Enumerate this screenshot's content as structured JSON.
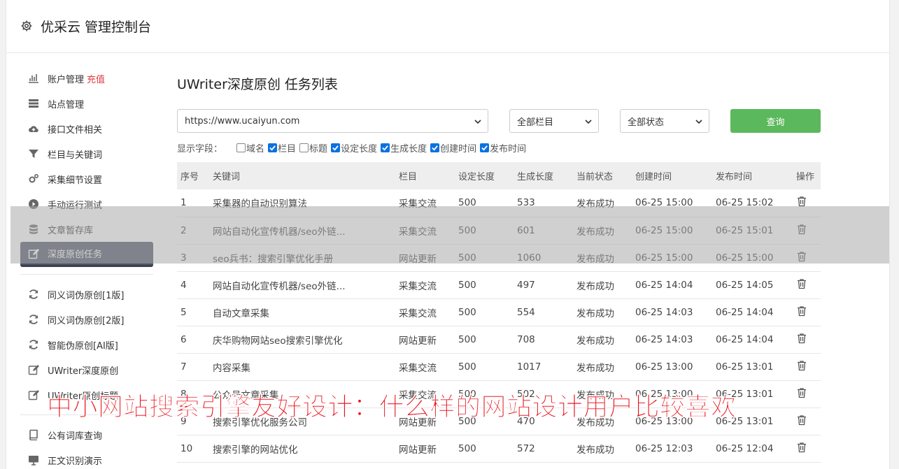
{
  "header": {
    "title": "优采云 管理控制台"
  },
  "sidebar": {
    "group1": [
      {
        "label": "账户管理",
        "accent": "充值",
        "icon": "bar-chart-icon"
      },
      {
        "label": "站点管理",
        "icon": "server-icon"
      },
      {
        "label": "接口文件相关",
        "icon": "cloud-upload-icon"
      },
      {
        "label": "栏目与关键词",
        "icon": "filter-icon"
      },
      {
        "label": "采集细节设置",
        "icon": "cogs-icon"
      },
      {
        "label": "手动运行测试",
        "icon": "play-icon"
      },
      {
        "label": "文章暂存库",
        "icon": "database-icon"
      },
      {
        "label": "深度原创任务",
        "icon": "edit-icon"
      }
    ],
    "group2": [
      {
        "label": "同义词伪原创[1版]",
        "icon": "refresh-icon"
      },
      {
        "label": "同义词伪原创[2版]",
        "icon": "refresh-icon"
      },
      {
        "label": "智能伪原创[AI版]",
        "icon": "refresh-icon"
      },
      {
        "label": "UWriter深度原创",
        "icon": "edit-icon"
      },
      {
        "label": "UWriter原创标题",
        "icon": "edit-icon"
      }
    ],
    "group3": [
      {
        "label": "公有词库查询",
        "icon": "book-icon"
      },
      {
        "label": "正文识别演示",
        "icon": "monitor-icon"
      }
    ]
  },
  "main": {
    "title": "UWriter深度原创 任务列表",
    "site_select": "https://www.ucaiyun.com",
    "column_select": "全部栏目",
    "status_select": "全部状态",
    "query_label": "查询",
    "fields_label": "显示字段：",
    "fields": [
      {
        "label": "域名",
        "checked": false
      },
      {
        "label": "栏目",
        "checked": true
      },
      {
        "label": "标题",
        "checked": false
      },
      {
        "label": "设定长度",
        "checked": true
      },
      {
        "label": "生成长度",
        "checked": true
      },
      {
        "label": "创建时间",
        "checked": true
      },
      {
        "label": "发布时间",
        "checked": true
      }
    ],
    "columns": [
      "序号",
      "关键词",
      "栏目",
      "设定长度",
      "生成长度",
      "当前状态",
      "创建时间",
      "发布时间",
      "操作"
    ],
    "rows": [
      [
        "1",
        "采集器的自动识别算法",
        "采集交流",
        "500",
        "533",
        "发布成功",
        "06-25 15:00",
        "06-25 15:02"
      ],
      [
        "2",
        "网站自动化宣传机器/seo外链...",
        "采集交流",
        "500",
        "601",
        "发布成功",
        "06-25 15:00",
        "06-25 15:01"
      ],
      [
        "3",
        "seo兵书：搜索引擎优化手册",
        "网站更新",
        "500",
        "1060",
        "发布成功",
        "06-25 15:00",
        "06-25 15:00"
      ],
      [
        "4",
        "网站自动化宣传机器/seo外链...",
        "采集交流",
        "500",
        "497",
        "发布成功",
        "06-25 14:04",
        "06-25 14:05"
      ],
      [
        "5",
        "自动文章采集",
        "采集交流",
        "500",
        "554",
        "发布成功",
        "06-25 14:03",
        "06-25 14:04"
      ],
      [
        "6",
        "庆华购物网站seo搜索引擎优化",
        "网站更新",
        "500",
        "708",
        "发布成功",
        "06-25 14:03",
        "06-25 14:04"
      ],
      [
        "7",
        "内容采集",
        "采集交流",
        "500",
        "1017",
        "发布成功",
        "06-25 13:00",
        "06-25 13:01"
      ],
      [
        "8",
        "公众号文章采集",
        "采集交流",
        "500",
        "502",
        "发布成功",
        "06-25 13:00",
        "06-25 13:01"
      ],
      [
        "9",
        "搜索引擎优化服务公司",
        "网站更新",
        "500",
        "470",
        "发布成功",
        "06-25 13:00",
        "06-25 13:01"
      ],
      [
        "10",
        "搜索引擎的网站优化",
        "网站更新",
        "500",
        "572",
        "发布成功",
        "06-25 12:03",
        "06-25 12:04"
      ]
    ]
  },
  "overlay": {
    "caption": "中小网站搜索引擎友好设计：什么样的网站设计用户比较喜欢"
  },
  "colors": {
    "accent": "#e4393c",
    "success": "#2e8b2e",
    "query_button": "#5cb85c",
    "active_nav": "#4e5566",
    "caption": "#e8141e"
  }
}
